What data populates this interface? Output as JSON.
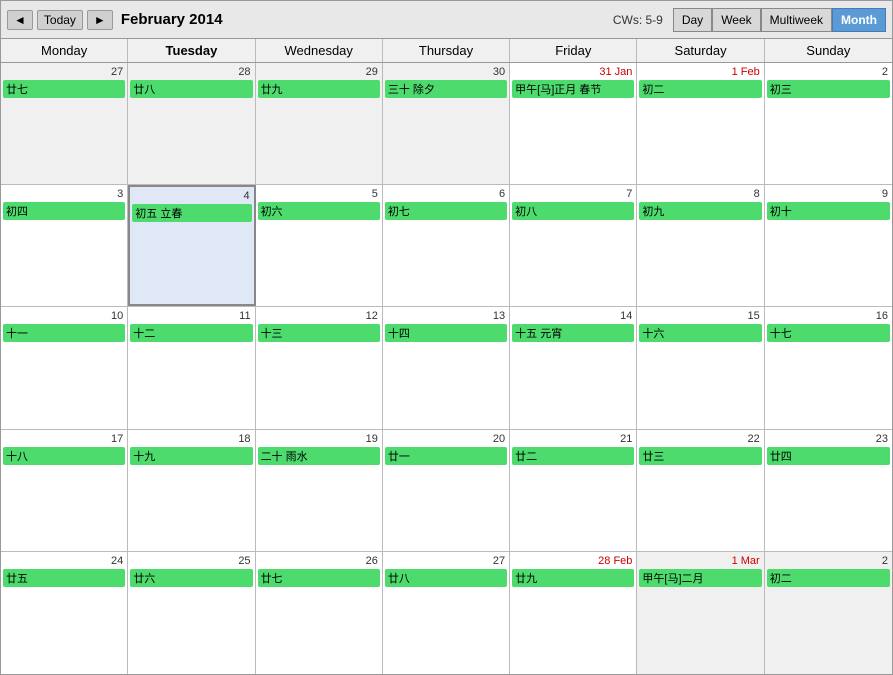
{
  "header": {
    "prev_label": "◄",
    "today_label": "Today",
    "next_label": "►",
    "title": "February 2014",
    "cw_info": "CWs: 5-9",
    "views": [
      "Day",
      "Week",
      "Multiweek",
      "Month"
    ],
    "active_view": "Month"
  },
  "day_headers": [
    "Monday",
    "Tuesday",
    "Wednesday",
    "Thursday",
    "Friday",
    "Saturday",
    "Sunday"
  ],
  "today_col_index": 1,
  "weeks": [
    {
      "cells": [
        {
          "num": "27",
          "other": true,
          "events": [
            "廿七"
          ]
        },
        {
          "num": "28",
          "other": true,
          "events": [
            "廿八"
          ]
        },
        {
          "num": "29",
          "other": true,
          "events": [
            "廿九"
          ]
        },
        {
          "num": "30",
          "other": true,
          "events": [
            "三十 除夕"
          ]
        },
        {
          "num": "31 Jan",
          "has_month": true,
          "events": [
            "甲午[马]正月 春节"
          ]
        },
        {
          "num": "1 Feb",
          "has_month": true,
          "events": [
            "初二"
          ]
        },
        {
          "num": "2",
          "events": [
            "初三"
          ]
        }
      ]
    },
    {
      "cells": [
        {
          "num": "3",
          "events": [
            "初四"
          ]
        },
        {
          "num": "4",
          "today": true,
          "events": [
            "初五 立春"
          ]
        },
        {
          "num": "5",
          "events": [
            "初六"
          ]
        },
        {
          "num": "6",
          "events": [
            "初七"
          ]
        },
        {
          "num": "7",
          "events": [
            "初八"
          ]
        },
        {
          "num": "8",
          "events": [
            "初九"
          ]
        },
        {
          "num": "9",
          "events": [
            "初十"
          ]
        }
      ]
    },
    {
      "cells": [
        {
          "num": "10",
          "events": [
            "十一"
          ]
        },
        {
          "num": "11",
          "events": [
            "十二"
          ]
        },
        {
          "num": "12",
          "events": [
            "十三"
          ]
        },
        {
          "num": "13",
          "events": [
            "十四"
          ]
        },
        {
          "num": "14",
          "events": [
            "十五 元宵"
          ]
        },
        {
          "num": "15",
          "events": [
            "十六"
          ]
        },
        {
          "num": "16",
          "events": [
            "十七"
          ]
        }
      ]
    },
    {
      "cells": [
        {
          "num": "17",
          "events": [
            "十八"
          ]
        },
        {
          "num": "18",
          "events": [
            "十九"
          ]
        },
        {
          "num": "19",
          "events": [
            "二十 雨水"
          ]
        },
        {
          "num": "20",
          "events": [
            "廿一"
          ]
        },
        {
          "num": "21",
          "events": [
            "廿二"
          ]
        },
        {
          "num": "22",
          "events": [
            "廿三"
          ]
        },
        {
          "num": "23",
          "events": [
            "廿四"
          ]
        }
      ]
    },
    {
      "cells": [
        {
          "num": "24",
          "events": [
            "廿五"
          ]
        },
        {
          "num": "25",
          "events": [
            "廿六"
          ]
        },
        {
          "num": "26",
          "events": [
            "廿七"
          ]
        },
        {
          "num": "27",
          "events": [
            "廿八"
          ]
        },
        {
          "num": "28 Feb",
          "has_month": true,
          "events": [
            "廿九"
          ]
        },
        {
          "num": "1 Mar",
          "has_month": true,
          "other": true,
          "events": [
            "甲午[马]二月"
          ]
        },
        {
          "num": "2",
          "other": true,
          "events": [
            "初二"
          ]
        }
      ]
    }
  ]
}
